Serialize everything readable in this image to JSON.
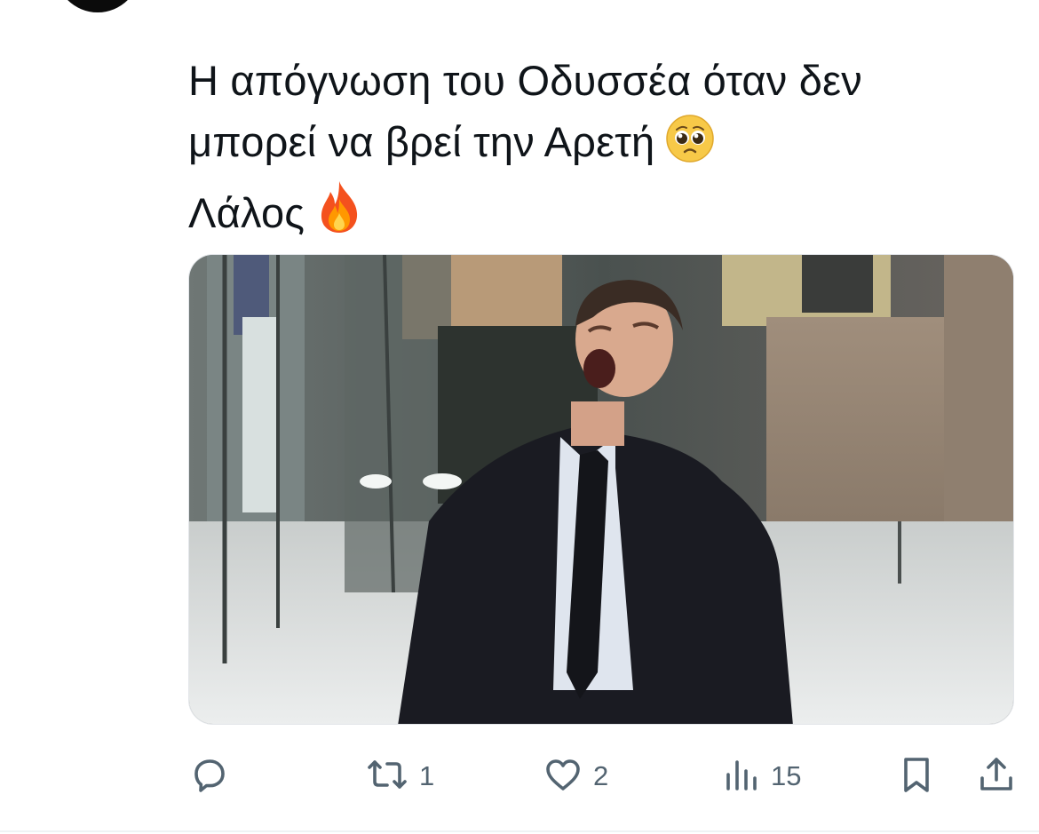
{
  "tweet": {
    "text_lines": [
      "Η απόγνωση του Οδυσσέα όταν δεν",
      "μπορεί να βρεί την Αρετή",
      "Λάλος"
    ],
    "emojis": [
      "pleading-face-emoji",
      "fire-emoji"
    ]
  },
  "actions": {
    "reply_count": "",
    "retweet_count": "1",
    "like_count": "2",
    "views_count": "15"
  },
  "icons": {
    "reply": "speech-bubble-icon",
    "retweet": "retweet-arrows-icon",
    "like": "heart-icon",
    "views": "bar-chart-icon",
    "bookmark": "bookmark-icon",
    "share": "share-upload-icon"
  },
  "colors": {
    "text": "#0f1419",
    "icon_gray": "#536471",
    "background": "#ffffff"
  }
}
